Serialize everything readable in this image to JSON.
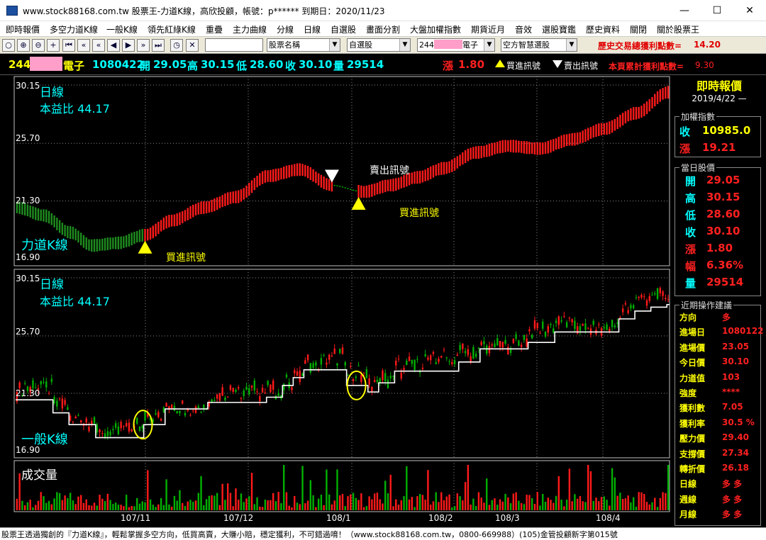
{
  "window": {
    "title": "www.stock88168.com.tw 股票王-力道K線，高欣投顧，帳號：p****** 到期日：2020/11/23",
    "controls": [
      "—",
      "☐",
      "✕"
    ]
  },
  "menu": [
    "即時報價",
    "多空力道K線",
    "一般K線",
    "領先紅綠K線",
    "重疊",
    "主力曲線",
    "分線",
    "日線",
    "自選股",
    "畫面分割",
    "大盤加權指數",
    "期貨近月",
    "音效",
    "選股寶鑑",
    "歷史資料",
    "關閉",
    "關於股票王"
  ],
  "toolbar": {
    "combo1": "股票名稱",
    "combo2": "自選股",
    "combo3_prefix": "244",
    "combo3_suffix": "電子",
    "combo4": "空方智慧選股",
    "hist_label": "歷史交易總獲利點數=",
    "hist_value": "14.20"
  },
  "quote": {
    "code_prefix": "244",
    "code_suffix": "電子",
    "id": "1080422",
    "open_label": "開",
    "open": "29.05",
    "high_label": "高",
    "high": "30.15",
    "low_label": "低",
    "low": "28.60",
    "close_label": "收",
    "close": "30.10",
    "vol_label": "量",
    "vol": "29514",
    "change_label": "漲",
    "change": "1.80",
    "buy_legend": "買進訊號",
    "sell_legend": "賣出訊號",
    "accum_label": "本頁累計獲利點數=",
    "accum_value": "9.30"
  },
  "upper_panel": {
    "period": "日線",
    "pe": "本益比 44.17",
    "name": "力道K線",
    "y_ticks": [
      "30.15",
      "25.70",
      "21.30",
      "16.90"
    ],
    "annotations": {
      "buy1": "買進訊號",
      "sell": "賣出訊號",
      "buy2": "買進訊號"
    }
  },
  "lower_panel": {
    "period": "日線",
    "pe": "本益比 44.17",
    "name": "一般K線",
    "y_ticks": [
      "30.15",
      "25.70",
      "21.30",
      "16.90"
    ]
  },
  "volume_panel": {
    "label": "成交量",
    "x_ticks": [
      "107/11",
      "107/12",
      "108/1",
      "108/2",
      "108/3",
      "108/4"
    ]
  },
  "side": {
    "title": "即時報價",
    "date": "2019/4/22 —",
    "index_box": {
      "caption": "加權指數",
      "rows": [
        {
          "label": "收",
          "value": "10985.0",
          "color": "#ffff00"
        },
        {
          "label": "漲",
          "value": "19.21",
          "color": "#ff2020"
        }
      ]
    },
    "day_box": {
      "caption": "當日股價",
      "rows": [
        {
          "label": "開",
          "value": "29.05",
          "color": "#ff2020"
        },
        {
          "label": "高",
          "value": "30.15",
          "color": "#ff2020"
        },
        {
          "label": "低",
          "value": "28.60",
          "color": "#ff2020"
        },
        {
          "label": "收",
          "value": "30.10",
          "color": "#ff2020"
        },
        {
          "label": "漲",
          "value": "1.80",
          "color": "#ff2020"
        },
        {
          "label": "幅",
          "value": "6.36%",
          "color": "#ff2020"
        },
        {
          "label": "量",
          "value": "29514",
          "color": "#ff2020"
        }
      ]
    },
    "advice_box": {
      "caption": "近期操作建議",
      "rows": [
        {
          "label": "方向",
          "value": "多"
        },
        {
          "label": "進場日",
          "value": "1080122"
        },
        {
          "label": "進場價",
          "value": "23.05"
        },
        {
          "label": "今日價",
          "value": "30.10"
        },
        {
          "label": "力道值",
          "value": "103"
        },
        {
          "label": "強度",
          "value": "****"
        },
        {
          "label": "獲利數",
          "value": "7.05"
        },
        {
          "label": "獲利率",
          "value": "30.5 %"
        },
        {
          "label": "壓力價",
          "value": "29.40"
        },
        {
          "label": "支撐價",
          "value": "27.34"
        },
        {
          "label": "轉折價",
          "value": "26.18"
        },
        {
          "label": "日線",
          "value": "多 多"
        },
        {
          "label": "週線",
          "value": "多 多"
        },
        {
          "label": "月線",
          "value": "多 多"
        }
      ]
    }
  },
  "status": "股票王透過獨創的『力道K線』，輕鬆掌握多空方向，低買高賣，大賺小賠，穩定獲利，不可錯過唷！（www.stock88168.com.tw，0800-669988）(105)金管投顧新字第015號",
  "chart_data": [
    {
      "type": "candlestick",
      "name": "力道K線",
      "ylim": [
        16.9,
        30.15
      ],
      "y_ticks": [
        30.15,
        25.7,
        21.3,
        16.9
      ],
      "x_ticks": [
        "107/11",
        "107/12",
        "108/1",
        "108/2",
        "108/3",
        "108/4"
      ],
      "smooth_anchors": [
        [
          0,
          20.8
        ],
        [
          10,
          20.2
        ],
        [
          20,
          18.9
        ],
        [
          28,
          17.9
        ],
        [
          38,
          18.1
        ],
        [
          48,
          18.7
        ],
        [
          58,
          19.8
        ],
        [
          70,
          20.8
        ],
        [
          82,
          21.6
        ],
        [
          94,
          23.2
        ],
        [
          106,
          23.7
        ],
        [
          118,
          22.5
        ],
        [
          130,
          22.0
        ],
        [
          140,
          22.5
        ],
        [
          150,
          23.1
        ],
        [
          160,
          23.8
        ],
        [
          172,
          25.0
        ],
        [
          184,
          25.5
        ],
        [
          196,
          25.3
        ],
        [
          208,
          26.0
        ],
        [
          220,
          26.8
        ],
        [
          232,
          28.0
        ],
        [
          244,
          29.6
        ]
      ],
      "signals": [
        {
          "type": "buy",
          "x": 48
        },
        {
          "type": "sell",
          "x": 118
        },
        {
          "type": "buy",
          "x": 128
        }
      ]
    },
    {
      "type": "candlestick",
      "name": "一般K線",
      "ylim": [
        16.9,
        30.15
      ],
      "step_line": [
        [
          0,
          20.8
        ],
        [
          9,
          20.8
        ],
        [
          14,
          19.8
        ],
        [
          20,
          18.9
        ],
        [
          30,
          17.9
        ],
        [
          42,
          17.9
        ],
        [
          48,
          18.9
        ],
        [
          56,
          20.1
        ],
        [
          72,
          20.6
        ],
        [
          94,
          21.0
        ],
        [
          100,
          21.9
        ],
        [
          104,
          22.5
        ],
        [
          108,
          23.1
        ],
        [
          124,
          21.9
        ],
        [
          132,
          21.4
        ],
        [
          136,
          22.1
        ],
        [
          142,
          23.0
        ],
        [
          160,
          23.0
        ],
        [
          166,
          23.7
        ],
        [
          174,
          24.7
        ],
        [
          192,
          25.2
        ],
        [
          202,
          26.0
        ],
        [
          220,
          26.0
        ],
        [
          226,
          27.0
        ],
        [
          232,
          27.6
        ],
        [
          238,
          27.9
        ],
        [
          244,
          28.1
        ]
      ]
    },
    {
      "type": "bar",
      "name": "成交量",
      "series_note": "daily volume, red = up day, green = down day"
    }
  ]
}
